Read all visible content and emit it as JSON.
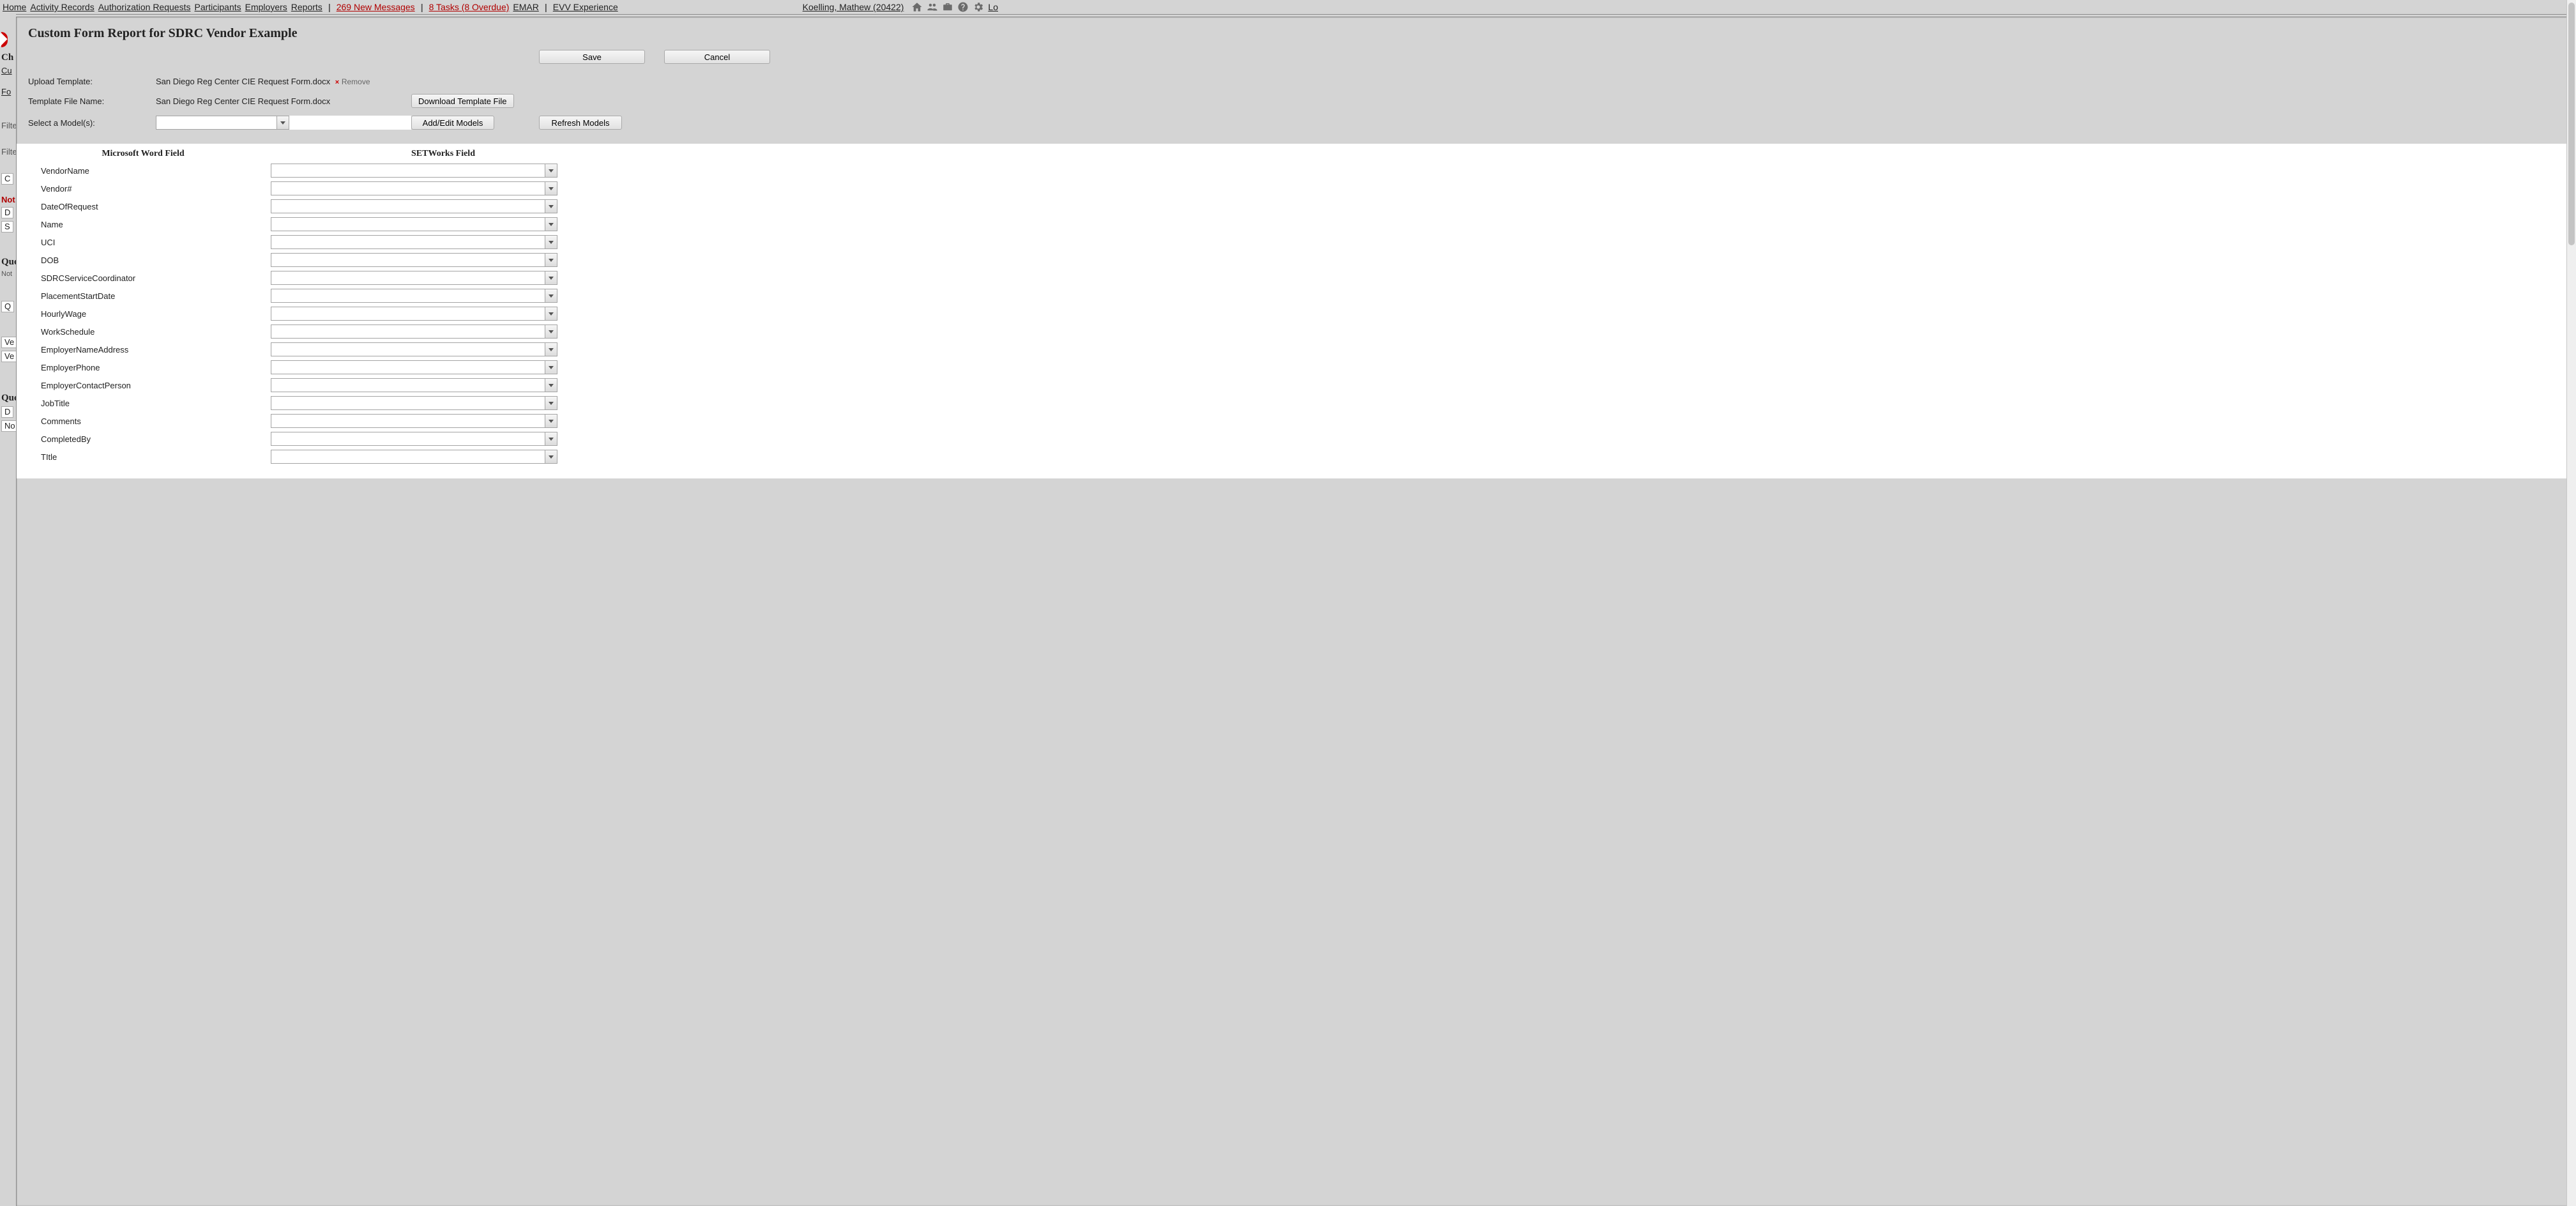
{
  "topnav": {
    "links": [
      "Home",
      "Activity Records",
      "Authorization Requests",
      "Participants",
      "Employers",
      "Reports"
    ],
    "messages": "269 New Messages",
    "tasks": "8 Tasks (8 Overdue)",
    "links2": [
      "EMAR",
      "EVV Experience"
    ],
    "user": "Koelling, Mathew  (20422)",
    "logout": "Lo"
  },
  "bg": {
    "ch": "Ch",
    "cu": "Cu",
    "fo": "Fo",
    "filter": "Filte",
    "filter2": "Filte",
    "c": "C",
    "not": "Not",
    "d": "D",
    "s": "S",
    "que": "Que",
    "notes": "Not",
    "q": "Q",
    "ve": "Ve",
    "ve2": "Ve",
    "que2": "Que",
    "d2": "D",
    "no": "No"
  },
  "modal": {
    "title": "Custom Form Report for SDRC Vendor Example",
    "save": "Save",
    "cancel": "Cancel",
    "upload_label": "Upload Template:",
    "file_name": "San Diego Reg Center CIE Request Form.docx",
    "remove": "Remove",
    "tmpl_label": "Template File Name:",
    "tmpl_value": "San Diego Reg Center CIE Request Form.docx",
    "download": "Download Template File",
    "selmodel_label": "Select a Model(s):",
    "addedit": "Add/Edit Models",
    "refresh": "Refresh Models",
    "head_word": "Microsoft Word Field",
    "head_set": "SETWorks Field",
    "fields": [
      "VendorName",
      "Vendor#",
      "DateOfRequest",
      "Name",
      "UCI",
      "DOB",
      "SDRCServiceCoordinator",
      "PlacementStartDate",
      "HourlyWage",
      "WorkSchedule",
      "EmployerNameAddress",
      "EmployerPhone",
      "EmployerContactPerson",
      "JobTitle",
      "Comments",
      "CompletedBy",
      "TItle"
    ]
  }
}
